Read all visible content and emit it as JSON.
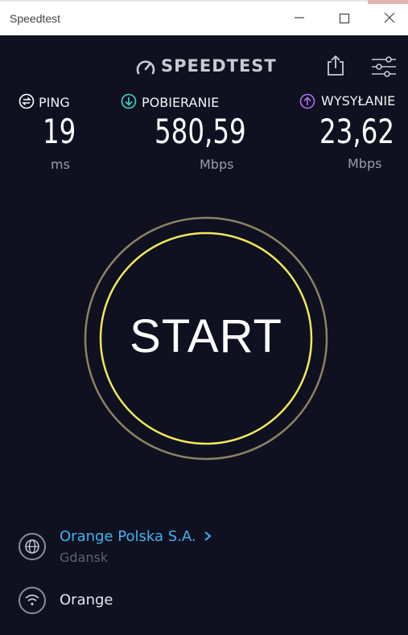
{
  "window": {
    "title": "Speedtest",
    "controls": [
      "minimize",
      "maximize",
      "close"
    ]
  },
  "header": {
    "logo_text": "SPEEDTEST",
    "share_icon": "share-icon",
    "settings_icon": "settings-sliders-icon"
  },
  "metrics": {
    "ping": {
      "label": "PING",
      "value": "19",
      "unit": "ms",
      "icon": "ping-icon",
      "color": "#ffffff"
    },
    "download": {
      "label": "POBIERANIE",
      "value": "580,59",
      "unit": "Mbps",
      "icon": "download-arrow-icon",
      "color": "#3ed8c8"
    },
    "upload": {
      "label": "WYSYŁANIE",
      "value": "23,62",
      "unit": "Mbps",
      "icon": "upload-arrow-icon",
      "color": "#b36cf0"
    }
  },
  "start_button": {
    "label": "START",
    "ring_color": "#f2e85a",
    "outer_ring_color": "#8a8360"
  },
  "server": {
    "isp_name": "Orange Polska S.A.",
    "location": "Gdansk",
    "icon": "globe-icon"
  },
  "connection": {
    "name": "Orange",
    "icon": "wifi-icon"
  }
}
